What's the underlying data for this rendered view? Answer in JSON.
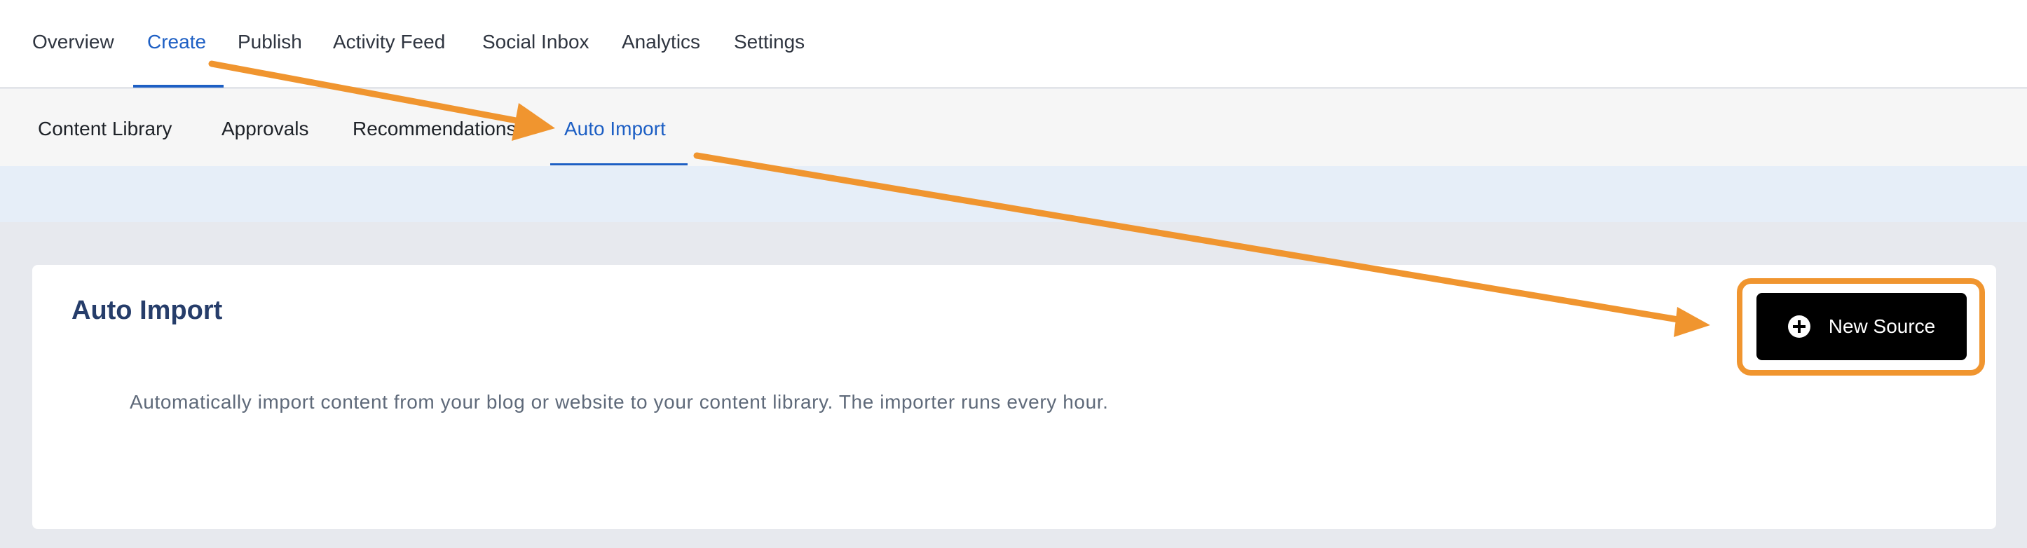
{
  "top_nav": {
    "tabs": [
      {
        "label": "Overview"
      },
      {
        "label": "Create",
        "active": true
      },
      {
        "label": "Publish"
      },
      {
        "label": "Activity Feed"
      },
      {
        "label": "Social Inbox"
      },
      {
        "label": "Analytics"
      },
      {
        "label": "Settings"
      }
    ]
  },
  "sub_nav": {
    "tabs": [
      {
        "label": "Content Library"
      },
      {
        "label": "Approvals"
      },
      {
        "label": "Recommendations"
      },
      {
        "label": "Auto Import",
        "active": true
      }
    ]
  },
  "card": {
    "title": "Auto Import",
    "description": "Automatically import content from your blog or website to your content library. The importer runs every hour.",
    "button_label": "New Source",
    "button_icon": "plus-circle-icon"
  },
  "colors": {
    "accent": "#1d5fc4",
    "annotation": "#f0952f",
    "title": "#263d6a"
  }
}
